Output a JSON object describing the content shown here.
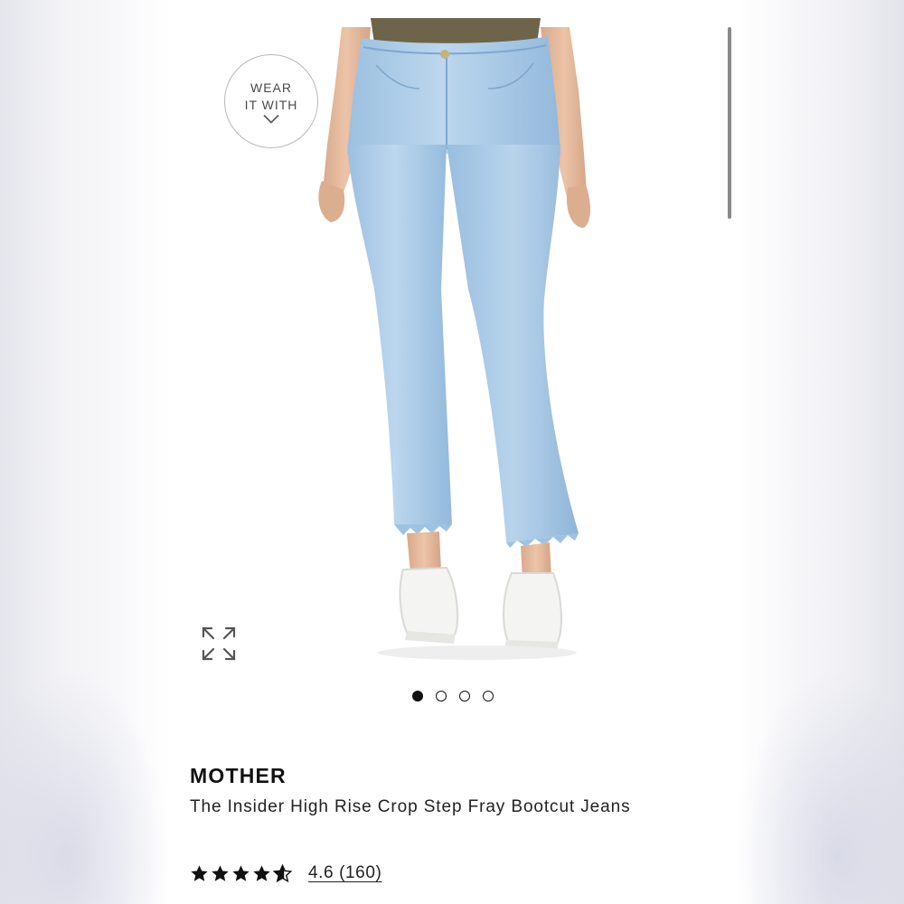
{
  "wear_it_with": {
    "line1": "WEAR",
    "line2": "IT WITH",
    "icon": "chevron-down-icon"
  },
  "image": {
    "subject": "light wash cropped bootcut jeans with white sneakers",
    "expand_icon": "expand-arrows-icon"
  },
  "carousel": {
    "total": 4,
    "active_index": 0
  },
  "product": {
    "brand": "MOTHER",
    "name": "The Insider High Rise Crop Step Fray Bootcut Jeans",
    "rating": 4.6,
    "rating_max": 5,
    "rating_text": "4.6 (160)"
  },
  "colors": {
    "denim": "#aacbe6",
    "denim_shade": "#8fb6d9",
    "skin": "#e3b89c",
    "top": "#6e6449",
    "sneaker": "#f4f4f2",
    "text": "#111111"
  }
}
